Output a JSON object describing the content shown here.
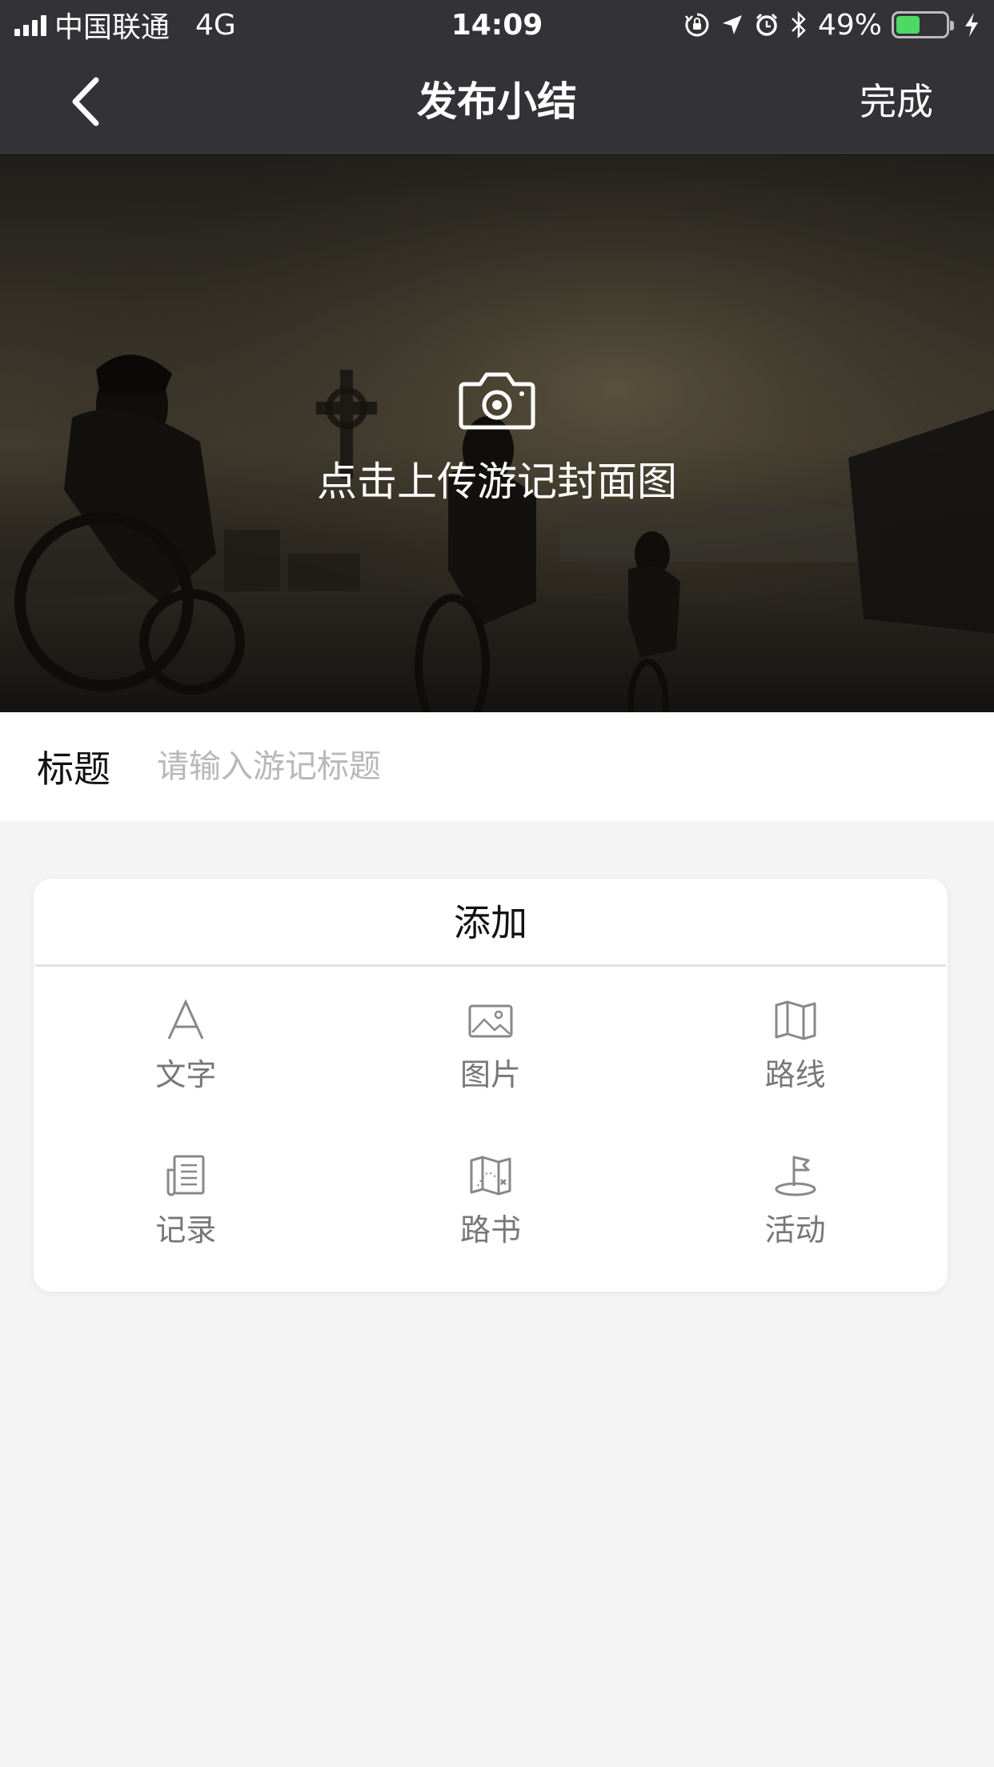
{
  "status_bar": {
    "carrier": "中国联通",
    "network": "4G",
    "time": "14:09",
    "battery_percent": "49%",
    "battery_level": 0.49,
    "battery_color": "#4cd964",
    "icons": [
      "signal-icon",
      "orientation-lock-icon",
      "location-arrow-icon",
      "alarm-icon",
      "bluetooth-icon",
      "battery-icon",
      "charging-icon"
    ]
  },
  "nav": {
    "back_icon": "chevron-left-icon",
    "title": "发布小结",
    "done_label": "完成"
  },
  "cover": {
    "icon": "camera-icon",
    "upload_text": "点击上传游记封面图"
  },
  "title_field": {
    "label": "标题",
    "value": "",
    "placeholder": "请输入游记标题"
  },
  "add_panel": {
    "header": "添加",
    "items": [
      {
        "label": "文字",
        "icon": "text-icon"
      },
      {
        "label": "图片",
        "icon": "image-icon"
      },
      {
        "label": "路线",
        "icon": "map-icon"
      },
      {
        "label": "记录",
        "icon": "record-icon"
      },
      {
        "label": "路书",
        "icon": "roadbook-icon"
      },
      {
        "label": "活动",
        "icon": "flag-icon"
      }
    ]
  },
  "colors": {
    "header_bg": "#333236",
    "page_bg": "#f4f4f4",
    "card_bg": "#ffffff",
    "muted_text": "#777777"
  }
}
